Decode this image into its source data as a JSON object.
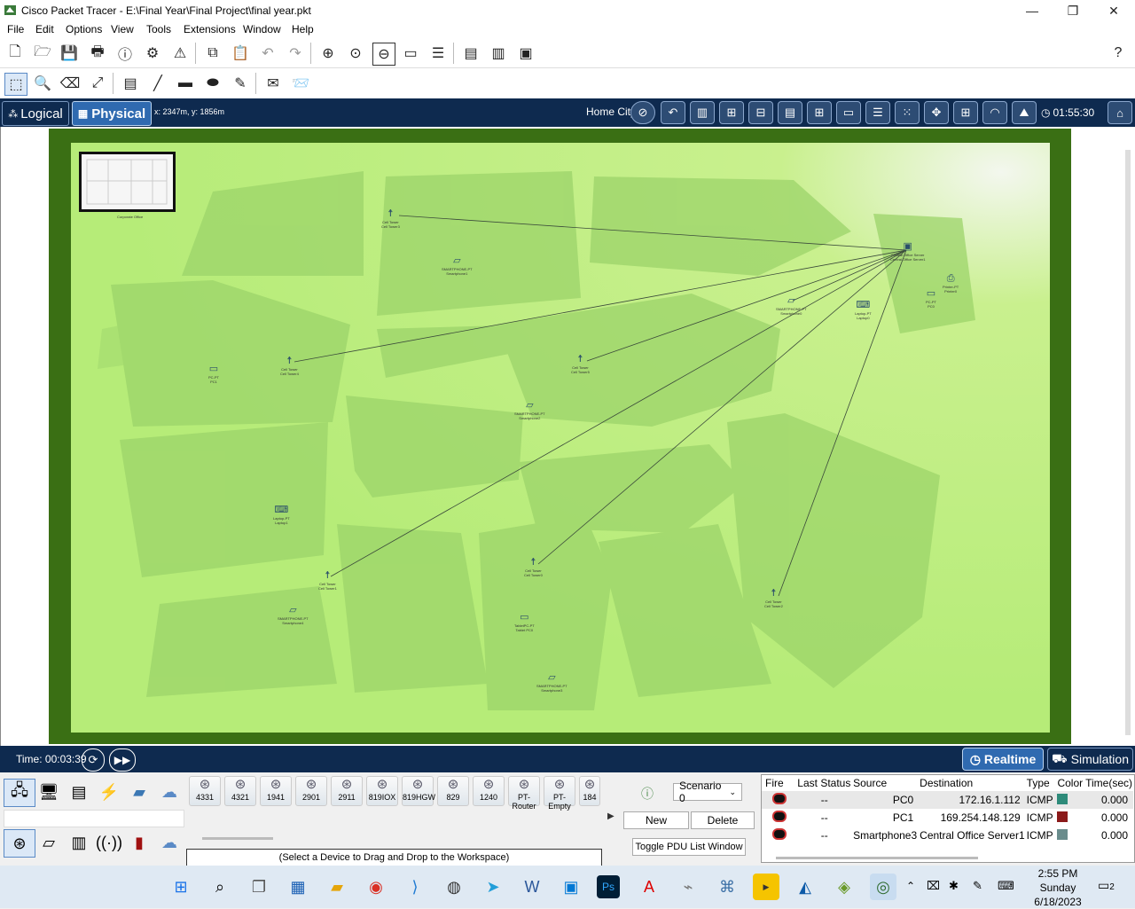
{
  "window": {
    "title": "Cisco Packet Tracer - E:\\Final Year\\Final Project\\final year.pkt"
  },
  "menu": [
    "File",
    "Edit",
    "Options",
    "View",
    "Tools",
    "Extensions",
    "Window",
    "Help"
  ],
  "nav": {
    "logical_label": "Logical",
    "physical_label": "Physical",
    "coords": "x: 2347m, y: 1856m",
    "location": "Home City",
    "clock": "01:55:30"
  },
  "map": {
    "office_label": "Corporate Office",
    "devices": [
      {
        "id": "tower3",
        "icon": "cell-tower-icon",
        "label": "Cell Tower\nCell Tower3"
      },
      {
        "id": "smartphone1",
        "icon": "smartphone-icon",
        "label": "SMARTPHONE-PT\nSmartphone1"
      },
      {
        "id": "server",
        "icon": "server-icon",
        "label": "Central Office Server\nCentral Office Server1"
      },
      {
        "id": "printer",
        "icon": "printer-icon",
        "label": "Printer-PT\nPrinter0"
      },
      {
        "id": "pc0",
        "icon": "pc-icon",
        "label": "PC-PT\nPC0"
      },
      {
        "id": "smartphone0",
        "icon": "smartphone-icon",
        "label": "SMARTPHONE-PT\nSmartphone0"
      },
      {
        "id": "laptop0",
        "icon": "laptop-icon",
        "label": "Laptop-PT\nLaptop0"
      },
      {
        "id": "pc1",
        "icon": "pc-icon",
        "label": "PC-PT\nPC1"
      },
      {
        "id": "tower4",
        "icon": "cell-tower-icon",
        "label": "Cell Tower\nCell Tower4"
      },
      {
        "id": "tower5",
        "icon": "cell-tower-icon",
        "label": "Cell Tower\nCell Tower5"
      },
      {
        "id": "smartphone2",
        "icon": "smartphone-icon",
        "label": "SMARTPHONE-PT\nSmartphone2"
      },
      {
        "id": "laptop1",
        "icon": "laptop-icon",
        "label": "Laptop-PT\nLaptop1"
      },
      {
        "id": "tower1",
        "icon": "cell-tower-icon",
        "label": "Cell Tower\nCell Tower1"
      },
      {
        "id": "tower0",
        "icon": "cell-tower-icon",
        "label": "Cell Tower\nCell Tower0"
      },
      {
        "id": "tower2",
        "icon": "cell-tower-icon",
        "label": "Cell Tower\nCell Tower2"
      },
      {
        "id": "smartphone4",
        "icon": "smartphone-icon",
        "label": "SMARTPHONE-PT\nSmartphone4"
      },
      {
        "id": "tablet",
        "icon": "tablet-icon",
        "label": "TabletPC-PT\nTablet PC0"
      },
      {
        "id": "smartphone3",
        "icon": "smartphone-icon",
        "label": "SMARTPHONE-PT\nSmartphone3"
      }
    ]
  },
  "bottom": {
    "time_label": "Time: 00:03:39",
    "realtime_label": "Realtime",
    "simulation_label": "Simulation"
  },
  "device_panel": {
    "models": [
      "4331",
      "4321",
      "1941",
      "2901",
      "2911",
      "819IOX",
      "819HGW",
      "829",
      "1240",
      "PT-Router",
      "PT-Empty",
      "184"
    ],
    "hint": "(Select a Device to Drag and Drop to the Workspace)"
  },
  "scenario": {
    "selected": "Scenario 0",
    "new_label": "New",
    "delete_label": "Delete",
    "toggle_label": "Toggle PDU List Window"
  },
  "pdu_table": {
    "headers": [
      "Fire",
      "Last Status",
      "Source",
      "Destination",
      "Type",
      "Color",
      "Time(sec)"
    ],
    "rows": [
      {
        "status": "--",
        "source": "PC0",
        "destination": "172.16.1.112",
        "type": "ICMP",
        "color": "#2e8b7a",
        "time": "0.000"
      },
      {
        "status": "--",
        "source": "PC1",
        "destination": "169.254.148.129",
        "type": "ICMP",
        "color": "#8b1a1a",
        "time": "0.000"
      },
      {
        "status": "--",
        "source": "Smartphone3",
        "destination": "Central Office Server1",
        "type": "ICMP",
        "color": "#6a8c8c",
        "time": "0.000"
      }
    ]
  },
  "taskbar": {
    "time": "2:55 PM",
    "day": "Sunday",
    "date": "6/18/2023",
    "notifications": "2"
  }
}
